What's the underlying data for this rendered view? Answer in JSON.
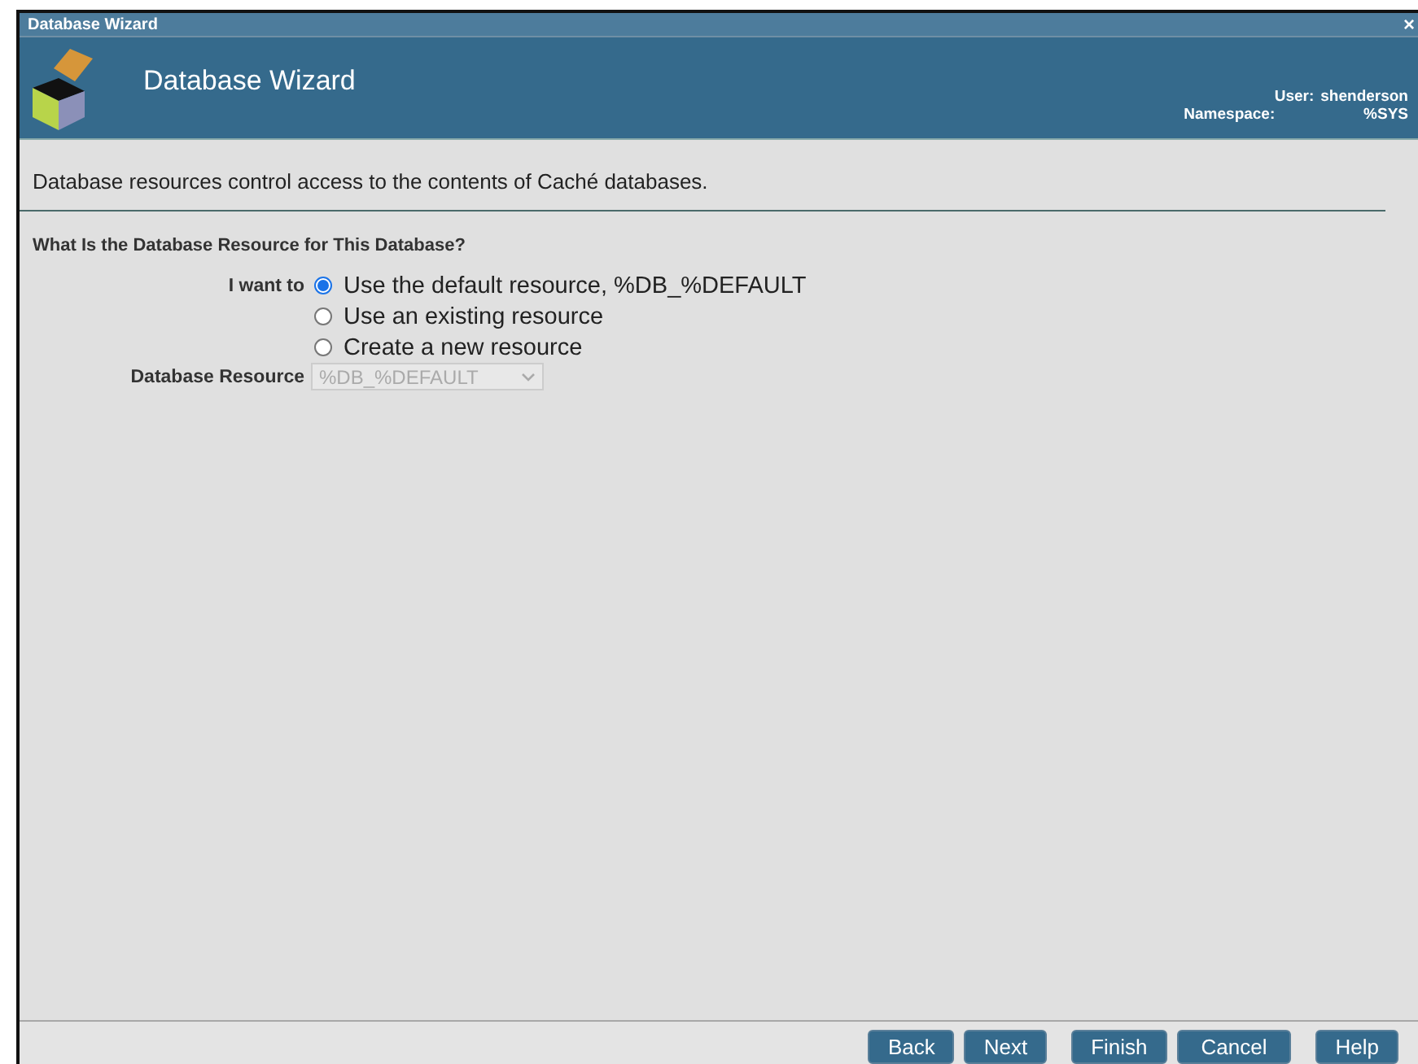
{
  "window": {
    "title": "Database Wizard",
    "close": "×"
  },
  "header": {
    "title": "Database Wizard",
    "user_label": "User:",
    "user": "shenderson",
    "namespace_label": "Namespace:",
    "namespace": "%SYS"
  },
  "description": "Database resources control access to the contents of Caché databases.",
  "section_title": "What Is the Database Resource for This Database?",
  "choice": {
    "label": "I want to",
    "options": [
      {
        "label": "Use the default resource, %DB_%DEFAULT",
        "selected": true
      },
      {
        "label": "Use an existing resource",
        "selected": false
      },
      {
        "label": "Create a new resource",
        "selected": false
      }
    ]
  },
  "resource": {
    "label": "Database Resource",
    "value": "%DB_%DEFAULT",
    "disabled": true
  },
  "buttons": [
    "Back",
    "Next",
    "Finish",
    "Cancel",
    "Help"
  ]
}
